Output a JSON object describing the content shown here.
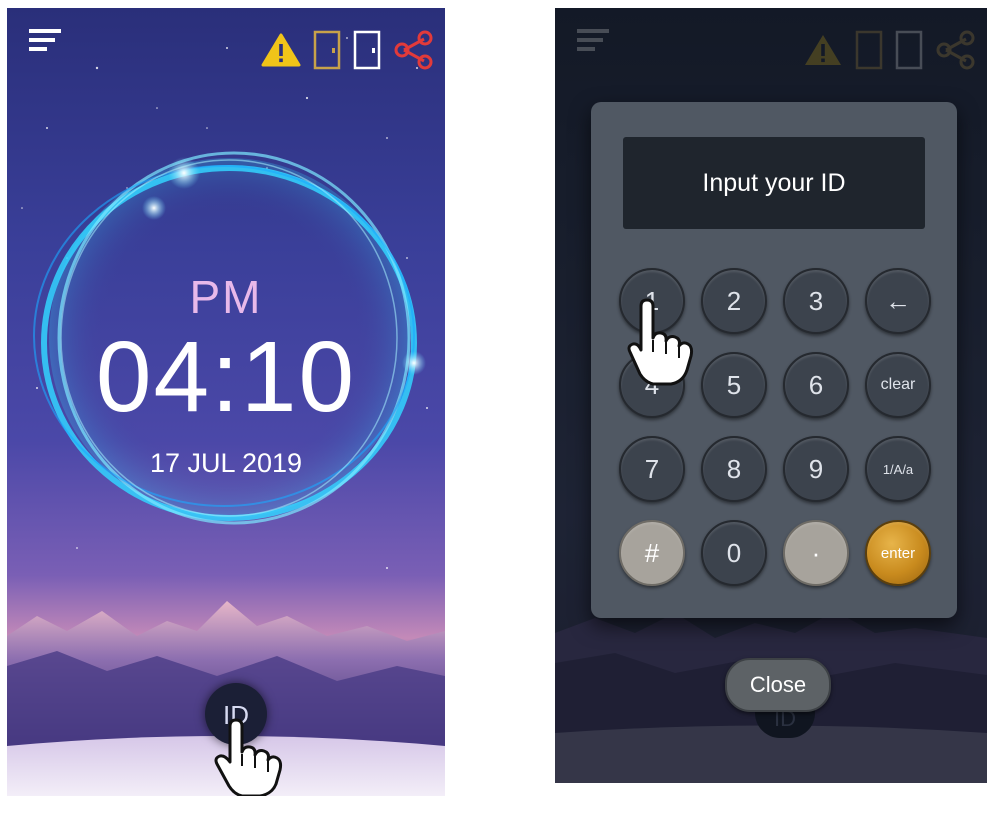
{
  "lock_screen": {
    "clock": {
      "ampm": "PM",
      "time": "04:10",
      "date": "17 JUL 2019"
    },
    "id_button_label": "ID",
    "icons": {
      "menu": "menu-icon",
      "warning": "warning-icon",
      "door1": "door-icon",
      "door2": "door-icon",
      "share": "share-icon"
    },
    "colors": {
      "warning": "#f0c419",
      "door_gold": "#c8a24a",
      "share": "#e23a3a",
      "ring": "#32d3ff"
    }
  },
  "keypad_screen": {
    "display_text": "Input your ID",
    "keys": [
      "1",
      "2",
      "3",
      "←",
      "4",
      "5",
      "6",
      "clear",
      "7",
      "8",
      "9",
      "1/A/a",
      "#",
      "0",
      "·",
      "enter"
    ],
    "close_label": "Close",
    "background_id_label": "ID",
    "colors": {
      "enter": "#c98b1e",
      "panel": "#505863"
    }
  }
}
